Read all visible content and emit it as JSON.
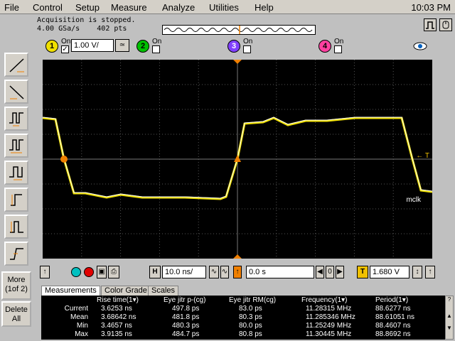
{
  "menu": {
    "items": [
      "File",
      "Control",
      "Setup",
      "Measure",
      "Analyze",
      "Utilities",
      "Help"
    ],
    "clock": "10:03 PM"
  },
  "status": {
    "acquisition": "Acquisition is stopped.",
    "sample_rate": "4.00 GSa/s    402 pts"
  },
  "channels": {
    "ch1": {
      "number": "1",
      "on_label": "On",
      "volts_per_div": "1.00 V/",
      "color": "#f0e000",
      "checked": true
    },
    "ch2": {
      "number": "2",
      "on_label": "On",
      "color": "#00c000"
    },
    "ch3": {
      "number": "3",
      "on_label": "On",
      "color": "#8040ff"
    },
    "ch4": {
      "number": "4",
      "on_label": "On",
      "color": "#ff40a0"
    }
  },
  "left_toolbar": {
    "more_label": "More",
    "more_page": "(1of 2)",
    "delete_line1": "Delete",
    "delete_line2": "All"
  },
  "scope": {
    "trigger_label": "← T",
    "signal_label": "mclk"
  },
  "controls": {
    "horizontal_label": "H",
    "time_per_div": "10.0 ns/",
    "delay": "0.0 s",
    "trigger_label": "T",
    "trigger_level": "1.680 V"
  },
  "tabs": [
    "Measurements",
    "Color Grade",
    "Scales"
  ],
  "measurements": {
    "columns": [
      "Rise time(1▾)",
      "Eye jitr p-(cg)",
      "Eye jitr RM(cg)",
      "Frequency(1▾)",
      "Period(1▾)"
    ],
    "rows": [
      {
        "label": "Current",
        "values": [
          "3.6253 ns",
          "497.8 ps",
          "83.0 ps",
          "11.28315 MHz",
          "88.6277 ns"
        ]
      },
      {
        "label": "Mean",
        "values": [
          "3.68642 ns",
          "481.8 ps",
          "80.3 ps",
          "11.285346 MHz",
          "88.61051 ns"
        ]
      },
      {
        "label": "Min",
        "values": [
          "3.4657 ns",
          "480.3 ps",
          "80.0 ps",
          "11.25249 MHz",
          "88.4607 ns"
        ]
      },
      {
        "label": "Max",
        "values": [
          "3.9135 ns",
          "484.7 ps",
          "80.8 ps",
          "11.30445 MHz",
          "88.8692 ns"
        ]
      }
    ]
  }
}
